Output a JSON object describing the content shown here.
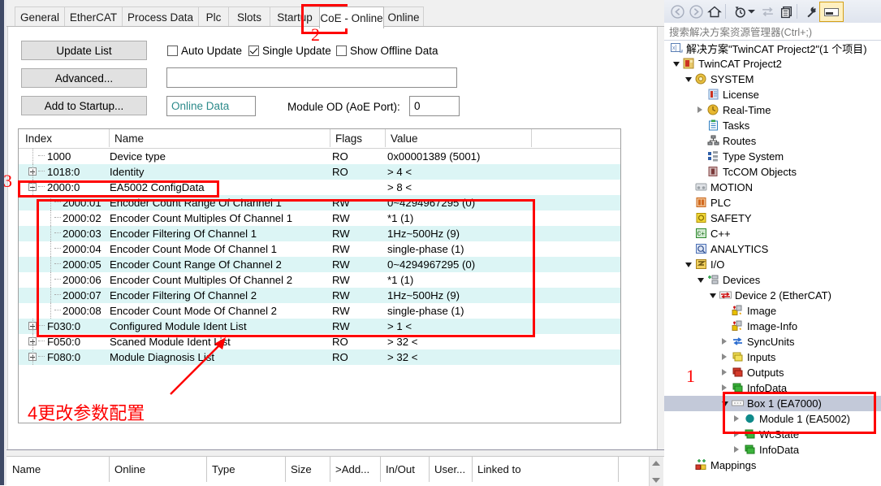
{
  "tabs": [
    {
      "label": "General",
      "selected": false
    },
    {
      "label": "EtherCAT",
      "selected": false
    },
    {
      "label": "Process Data",
      "selected": false
    },
    {
      "label": "Plc",
      "selected": false
    },
    {
      "label": "Slots",
      "selected": false
    },
    {
      "label": "Startup",
      "selected": false
    },
    {
      "label": "CoE - Online",
      "selected": true
    },
    {
      "label": "Online",
      "selected": false
    }
  ],
  "toolbar": {
    "update_list": "Update List",
    "advanced": "Advanced...",
    "add_to_startup": "Add to Startup...",
    "auto_update": "Auto Update",
    "single_update": "Single Update",
    "show_offline_data": "Show Offline Data",
    "auto_update_checked": false,
    "single_update_checked": true,
    "show_offline_checked": false,
    "filter_value": "",
    "online_data": "Online Data",
    "module_od_label": "Module OD (AoE Port):",
    "module_od_value": "0"
  },
  "table": {
    "headers": [
      "Index",
      "Name",
      "Flags",
      "Value"
    ],
    "rows": [
      {
        "index": "1000",
        "name": "Device type",
        "flags": "RO",
        "value": "0x00001389 (5001)",
        "toggle": "none",
        "depth": 1,
        "cyan": false
      },
      {
        "index": "1018:0",
        "name": "Identity",
        "flags": "RO",
        "value": "> 4 <",
        "toggle": "plus",
        "depth": 1,
        "cyan": true
      },
      {
        "index": "2000:0",
        "name": "EA5002 ConfigData",
        "flags": "",
        "value": "> 8 <",
        "toggle": "minus",
        "depth": 1,
        "cyan": false
      },
      {
        "index": "2000:01",
        "name": "Encoder Count Range Of Channel 1",
        "flags": "RW",
        "value": "0~4294967295 (0)",
        "toggle": "none",
        "depth": 2,
        "cyan": true
      },
      {
        "index": "2000:02",
        "name": "Encoder Count Multiples Of Channel 1",
        "flags": "RW",
        "value": "*1 (1)",
        "toggle": "none",
        "depth": 2,
        "cyan": false
      },
      {
        "index": "2000:03",
        "name": "Encoder Filtering Of Channel 1",
        "flags": "RW",
        "value": "1Hz~500Hz (9)",
        "toggle": "none",
        "depth": 2,
        "cyan": true
      },
      {
        "index": "2000:04",
        "name": "Encoder Count Mode Of Channel 1",
        "flags": "RW",
        "value": "single-phase (1)",
        "toggle": "none",
        "depth": 2,
        "cyan": false
      },
      {
        "index": "2000:05",
        "name": "Encoder Count Range Of Channel 2",
        "flags": "RW",
        "value": "0~4294967295 (0)",
        "toggle": "none",
        "depth": 2,
        "cyan": true
      },
      {
        "index": "2000:06",
        "name": "Encoder Count Multiples Of Channel 2",
        "flags": "RW",
        "value": "*1 (1)",
        "toggle": "none",
        "depth": 2,
        "cyan": false
      },
      {
        "index": "2000:07",
        "name": "Encoder Filtering Of Channel 2",
        "flags": "RW",
        "value": "1Hz~500Hz (9)",
        "toggle": "none",
        "depth": 2,
        "cyan": true
      },
      {
        "index": "2000:08",
        "name": "Encoder Count Mode Of Channel 2",
        "flags": "RW",
        "value": "single-phase (1)",
        "toggle": "none",
        "depth": 2,
        "cyan": false
      },
      {
        "index": "F030:0",
        "name": "Configured Module Ident List",
        "flags": "RW",
        "value": "> 1 <",
        "toggle": "plus",
        "depth": 1,
        "cyan": true
      },
      {
        "index": "F050:0",
        "name": "Scaned Module Ident List",
        "flags": "RO",
        "value": "> 32 <",
        "toggle": "plus",
        "depth": 1,
        "cyan": false
      },
      {
        "index": "F080:0",
        "name": "Module Diagnosis List",
        "flags": "RO",
        "value": "> 32 <",
        "toggle": "plus",
        "depth": 1,
        "cyan": true
      }
    ]
  },
  "bottom_grid": {
    "headers": [
      "Name",
      "Online",
      "Type",
      "Size",
      ">Add...",
      "In/Out",
      "User...",
      "Linked to"
    ]
  },
  "solution_explorer": {
    "toolbar_icons": [
      "back-icon",
      "forward-icon",
      "home-icon",
      "sync-with-active-document-icon",
      "refresh-icon",
      "collapse-all-icon",
      "properties-icon",
      "preview-selected-items-icon"
    ],
    "search_placeholder": "搜索解决方案资源管理器(Ctrl+;)",
    "tree": [
      {
        "label": "解决方案\"TwinCAT Project2\"(1 个项目)",
        "depth": 0,
        "toggle": "none",
        "icon": "solution-icon",
        "icon_color": "#5a7fb5",
        "selected": false
      },
      {
        "label": "TwinCAT Project2",
        "depth": 1,
        "toggle": "open",
        "icon": "project-icon",
        "icon_color": "#c0392b",
        "selected": false
      },
      {
        "label": "SYSTEM",
        "depth": 2,
        "toggle": "open",
        "icon": "system-icon",
        "icon_color": "#d9a520",
        "selected": false
      },
      {
        "label": "License",
        "depth": 3,
        "toggle": "none",
        "icon": "license-icon",
        "icon_color": "#6f96c6",
        "selected": false
      },
      {
        "label": "Real-Time",
        "depth": 3,
        "toggle": "closed",
        "icon": "realtime-icon",
        "icon_color": "#e0a800",
        "selected": false
      },
      {
        "label": "Tasks",
        "depth": 3,
        "toggle": "none",
        "icon": "tasks-icon",
        "icon_color": "#2f7fc1",
        "selected": false
      },
      {
        "label": "Routes",
        "depth": 3,
        "toggle": "none",
        "icon": "routes-icon",
        "icon_color": "#4a4a4a",
        "selected": false
      },
      {
        "label": "Type System",
        "depth": 3,
        "toggle": "none",
        "icon": "type-system-icon",
        "icon_color": "#2f5fa8",
        "selected": false
      },
      {
        "label": "TcCOM Objects",
        "depth": 3,
        "toggle": "none",
        "icon": "tccom-objects-icon",
        "icon_color": "#8a4b4b",
        "selected": false
      },
      {
        "label": "MOTION",
        "depth": 2,
        "toggle": "none",
        "icon": "motion-icon",
        "icon_color": "#9aa0a6",
        "selected": false
      },
      {
        "label": "PLC",
        "depth": 2,
        "toggle": "none",
        "icon": "plc-icon",
        "icon_color": "#d2691e",
        "selected": false
      },
      {
        "label": "SAFETY",
        "depth": 2,
        "toggle": "none",
        "icon": "safety-icon",
        "icon_color": "#e8c000",
        "selected": false
      },
      {
        "label": "C++",
        "depth": 2,
        "toggle": "none",
        "icon": "cpp-icon",
        "icon_color": "#2e8b2e",
        "selected": false
      },
      {
        "label": "ANALYTICS",
        "depth": 2,
        "toggle": "none",
        "icon": "analytics-icon",
        "icon_color": "#4a6fb5",
        "selected": false
      },
      {
        "label": "I/O",
        "depth": 2,
        "toggle": "open",
        "icon": "io-icon",
        "icon_color": "#d9a520",
        "selected": false
      },
      {
        "label": "Devices",
        "depth": 3,
        "toggle": "open",
        "icon": "devices-icon",
        "icon_color": "#9aa0a6",
        "selected": false
      },
      {
        "label": "Device 2 (EtherCAT)",
        "depth": 4,
        "toggle": "open",
        "icon": "ethercat-device-icon",
        "icon_color": "#c0392b",
        "selected": false
      },
      {
        "label": "Image",
        "depth": 5,
        "toggle": "none",
        "icon": "image-icon",
        "icon_color": "#e8c000",
        "selected": false
      },
      {
        "label": "Image-Info",
        "depth": 5,
        "toggle": "none",
        "icon": "image-info-icon",
        "icon_color": "#e8c000",
        "selected": false
      },
      {
        "label": "SyncUnits",
        "depth": 5,
        "toggle": "closed",
        "icon": "syncunits-icon",
        "icon_color": "#2f6fd0",
        "selected": false
      },
      {
        "label": "Inputs",
        "depth": 5,
        "toggle": "closed",
        "icon": "inputs-icon",
        "icon_color": "#e8d000",
        "selected": false
      },
      {
        "label": "Outputs",
        "depth": 5,
        "toggle": "closed",
        "icon": "outputs-icon",
        "icon_color": "#cc1111",
        "selected": false
      },
      {
        "label": "InfoData",
        "depth": 5,
        "toggle": "closed",
        "icon": "infodata-icon",
        "icon_color": "#22aa22",
        "selected": false
      },
      {
        "label": "Box 1 (EA7000)",
        "depth": 5,
        "toggle": "open",
        "icon": "box-icon",
        "icon_color": "#ffffff",
        "selected": true
      },
      {
        "label": "Module 1 (EA5002)",
        "depth": 6,
        "toggle": "closed",
        "icon": "module-icon",
        "icon_color": "#1b8a8a",
        "selected": false
      },
      {
        "label": "WcState",
        "depth": 6,
        "toggle": "closed",
        "icon": "wcstate-icon",
        "icon_color": "#22aa22",
        "selected": false
      },
      {
        "label": "InfoData",
        "depth": 6,
        "toggle": "closed",
        "icon": "infodata-icon",
        "icon_color": "#22aa22",
        "selected": false
      },
      {
        "label": "Mappings",
        "depth": 2,
        "toggle": "none",
        "icon": "mappings-icon",
        "icon_color": "#cc1111",
        "selected": false
      }
    ]
  },
  "annotations": {
    "marker_1": "1",
    "marker_2": "2",
    "marker_3": "3",
    "marker_4_text": "4更改参数配置",
    "color": "#fe0000"
  }
}
